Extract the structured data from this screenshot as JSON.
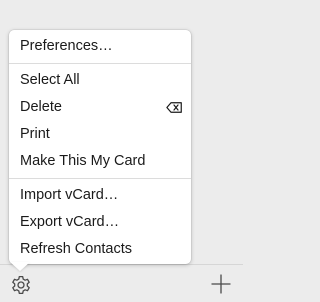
{
  "menu": {
    "items": [
      {
        "label": "Preferences…"
      },
      {
        "label": "Select All"
      },
      {
        "label": "Delete",
        "shortcut_icon": "delete-key-icon"
      },
      {
        "label": "Print"
      },
      {
        "label": "Make This My Card"
      },
      {
        "label": "Import vCard…"
      },
      {
        "label": "Export vCard…"
      },
      {
        "label": "Refresh Contacts"
      }
    ]
  },
  "toolbar": {
    "left_icon": "gear-icon",
    "right_icon": "plus-icon"
  },
  "colors": {
    "background": "#ececec",
    "menu_background": "#ffffff",
    "text": "#1a1a1a",
    "separator": "#dcdcdc"
  }
}
